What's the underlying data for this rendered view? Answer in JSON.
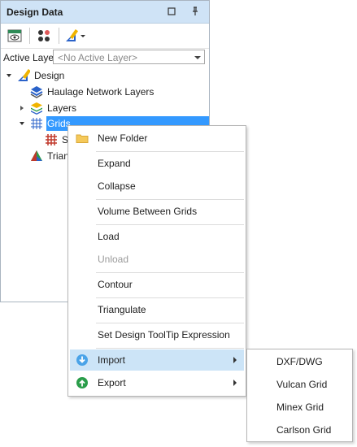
{
  "panel": {
    "title": "Design Data",
    "active_layer_label": "Active Layer",
    "active_layer_value": "<No Active Layer>"
  },
  "tree": {
    "root": "Design",
    "items": [
      {
        "label": "Haulage Network Layers",
        "icon": "layers-stack-icon"
      },
      {
        "label": "Layers",
        "icon": "layers-icon"
      },
      {
        "label": "Grids",
        "icon": "grid-icon",
        "selected": true
      },
      {
        "label": "S",
        "icon": "grid-red-icon"
      },
      {
        "label": "Trian",
        "icon": "triangulation-icon"
      }
    ]
  },
  "menu": {
    "items": [
      {
        "label": "New Folder",
        "icon": "folder-icon"
      },
      {
        "label": "Expand"
      },
      {
        "label": "Collapse"
      },
      {
        "label": "Volume Between Grids"
      },
      {
        "label": "Load"
      },
      {
        "label": "Unload",
        "disabled": true
      },
      {
        "label": "Contour"
      },
      {
        "label": "Triangulate"
      },
      {
        "label": "Set Design ToolTip Expression"
      },
      {
        "label": "Import",
        "icon": "import-icon",
        "submenu": true,
        "highlighted": true
      },
      {
        "label": "Export",
        "icon": "export-icon",
        "submenu": true
      }
    ]
  },
  "submenu": {
    "items": [
      "DXF/DWG",
      "Vulcan Grid",
      "Minex Grid",
      "Carlson Grid"
    ]
  },
  "colors": {
    "titlebar": "#cfe3f6",
    "selection": "#3399ff",
    "menu_highlight": "#cce4f7"
  }
}
